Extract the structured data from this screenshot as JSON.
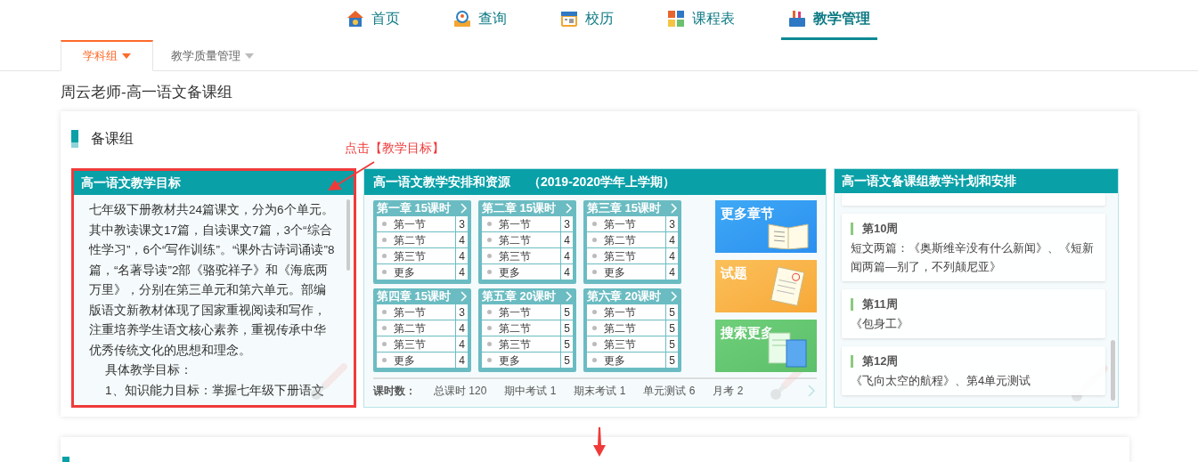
{
  "nav": [
    {
      "label": "首页",
      "selected": false,
      "kind": "home"
    },
    {
      "label": "查询",
      "selected": false,
      "kind": "search"
    },
    {
      "label": "校历",
      "selected": false,
      "kind": "calendar"
    },
    {
      "label": "课程表",
      "selected": false,
      "kind": "grid"
    },
    {
      "label": "教学管理",
      "selected": true,
      "kind": "tools"
    }
  ],
  "subtabs": [
    {
      "label": "学科组",
      "selected": true
    },
    {
      "label": "教学质量管理",
      "selected": false
    }
  ],
  "page_title": "周云老师-高一语文备课组",
  "section_title": "备课组",
  "annotation": "点击【教学目标】",
  "goal_panel": {
    "title": "高一语文教学目标",
    "paragraph": "七年级下册教材共24篇课文，分为6个单元。其中教读课文17篇，自读课文7篇，3个“综合性学习”，6个“写作训练”。“课外古诗词诵读”8篇，“名著导读”2部《骆驼祥子》和《海底两万里》，分别在第三单元和第六单元。部编版语文新教材体现了国家重视阅读和写作，注重培养学生语文核心素养，重视传承中华优秀传统文化的思想和理念。",
    "lines": [
      "具体教学目标：",
      "1、知识能力目标：掌握七年级下册语文"
    ]
  },
  "resource_panel": {
    "title": "高一语文教学安排和资源",
    "period": "（2019-2020学年上学期）",
    "chapters": [
      {
        "title": "第一章",
        "hours": "15课时",
        "sections": [
          {
            "name": "第一节",
            "count": "3"
          },
          {
            "name": "第二节",
            "count": "4"
          },
          {
            "name": "第三节",
            "count": "4"
          },
          {
            "name": "更多",
            "count": "4"
          }
        ]
      },
      {
        "title": "第二章",
        "hours": "15课时",
        "sections": [
          {
            "name": "第一节",
            "count": "3"
          },
          {
            "name": "第二节",
            "count": "4"
          },
          {
            "name": "第三节",
            "count": "4"
          },
          {
            "name": "更多",
            "count": "4"
          }
        ]
      },
      {
        "title": "第三章",
        "hours": "15课时",
        "sections": [
          {
            "name": "第一节",
            "count": "3"
          },
          {
            "name": "第二节",
            "count": "4"
          },
          {
            "name": "第三节",
            "count": "4"
          },
          {
            "name": "更多",
            "count": "4"
          }
        ]
      },
      {
        "title": "第四章",
        "hours": "15课时",
        "sections": [
          {
            "name": "第一节",
            "count": "3"
          },
          {
            "name": "第二节",
            "count": "4"
          },
          {
            "name": "第三节",
            "count": "4"
          },
          {
            "name": "更多",
            "count": "4"
          }
        ]
      },
      {
        "title": "第五章",
        "hours": "20课时",
        "sections": [
          {
            "name": "第一节",
            "count": "5"
          },
          {
            "name": "第二节",
            "count": "5"
          },
          {
            "name": "第三节",
            "count": "5"
          },
          {
            "name": "更多",
            "count": "5"
          }
        ]
      },
      {
        "title": "第六章",
        "hours": "20课时",
        "sections": [
          {
            "name": "第一节",
            "count": "5"
          },
          {
            "name": "第二节",
            "count": "5"
          },
          {
            "name": "第三节",
            "count": "5"
          },
          {
            "name": "更多",
            "count": "5"
          }
        ]
      }
    ],
    "tiles": [
      {
        "label": "更多章节",
        "kind": "book"
      },
      {
        "label": "试题",
        "kind": "exam"
      },
      {
        "label": "搜索更多",
        "kind": "search"
      }
    ],
    "summary_label": "课时数：",
    "summary": [
      "总课时 120",
      "期中考试 1",
      "期末考试 1",
      "单元测试 6",
      "月考 2"
    ]
  },
  "plan_panel": {
    "title": "高一语文备课组教学计划和安排",
    "weeks": [
      {
        "week": "第10周",
        "text": "短文两篇：《奥斯维辛没有什么新闻》、《短新闻两篇—别了，不列颠尼亚》"
      },
      {
        "week": "第11周",
        "text": "《包身工》"
      },
      {
        "week": "第12周",
        "text": "《飞向太空的航程》、第4单元测试"
      }
    ]
  }
}
